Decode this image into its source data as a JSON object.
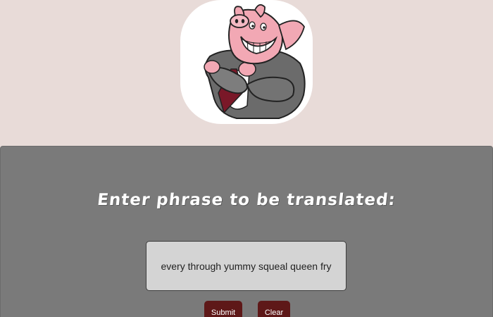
{
  "colors": {
    "background": "#e8dbd8",
    "panel": "#7a7a7a",
    "button": "#5e1818",
    "input_bg": "#d4d4d4"
  },
  "logo": {
    "icon": "pig-in-suit-mascot-icon"
  },
  "translator": {
    "prompt": "Enter phrase to be translated:",
    "input_value": "every through yummy squeal queen fry",
    "submit_label": "Submit",
    "clear_label": "Clear"
  }
}
